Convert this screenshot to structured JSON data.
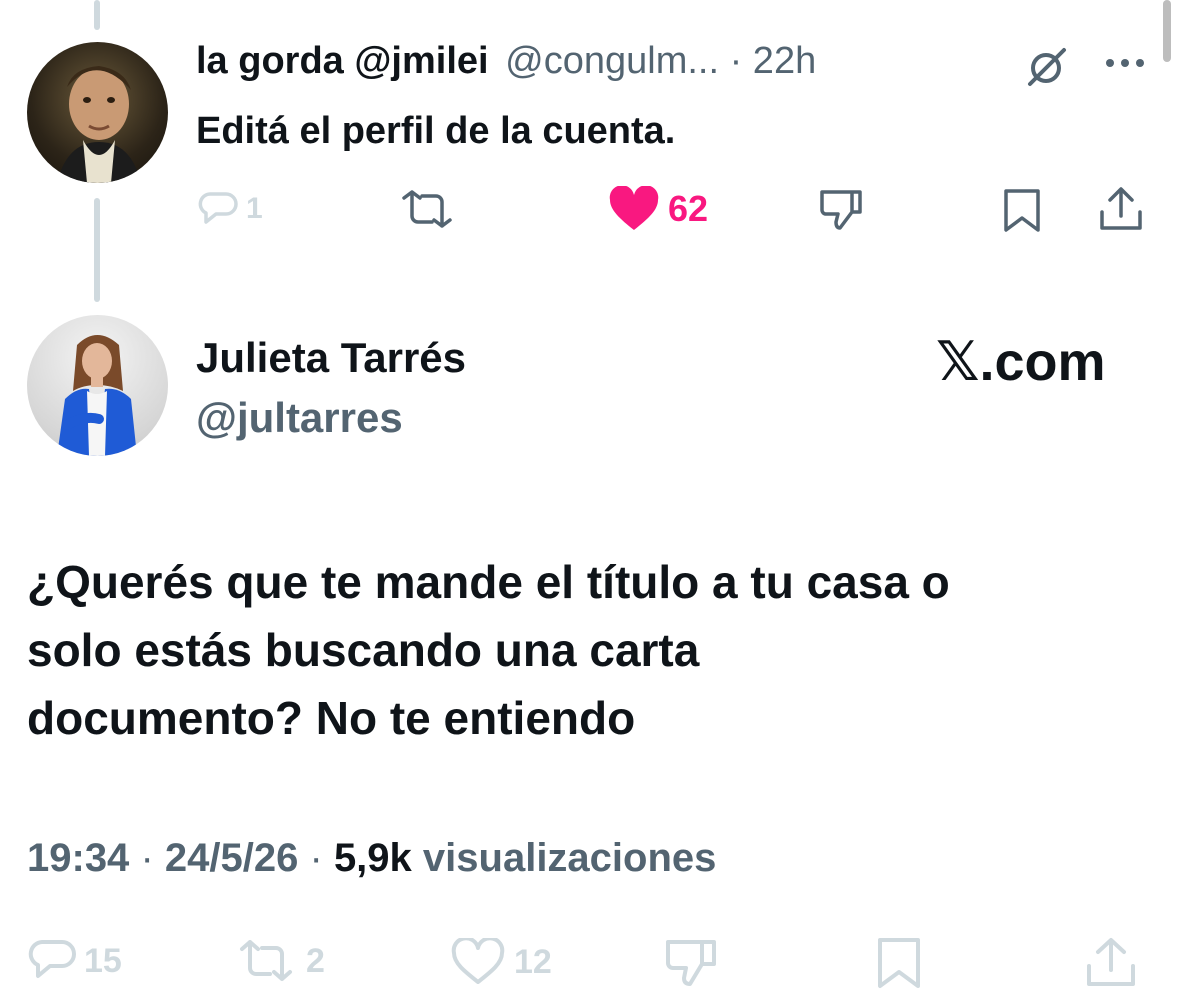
{
  "reply_tweet": {
    "display_name": "la gorda @jmilei",
    "handle": "@congulm...",
    "time": "· 22h",
    "text": "Editá el perfil de la cuenta.",
    "actions": {
      "replies": "1",
      "reposts": "",
      "likes": "62",
      "liked": true
    }
  },
  "main_tweet": {
    "display_name": "Julieta Tarrés",
    "handle": "@jultarres",
    "watermark": "𝕏.com",
    "text_lines": [
      "¿Querés que te mande el título a tu casa o",
      "solo estás buscando una carta",
      "documento? No te entiendo"
    ],
    "meta": {
      "time": "19:34",
      "sep1": "·",
      "date": "24/5/26",
      "sep2": "·",
      "views_count": "5,9k",
      "views_label": "visualizaciones"
    },
    "actions": {
      "replies": "15",
      "reposts": "2",
      "likes": "12"
    }
  },
  "colors": {
    "text": "#0f1419",
    "muted": "#536471",
    "like_pink": "#f91880",
    "faded_icon": "#cfd9de"
  }
}
